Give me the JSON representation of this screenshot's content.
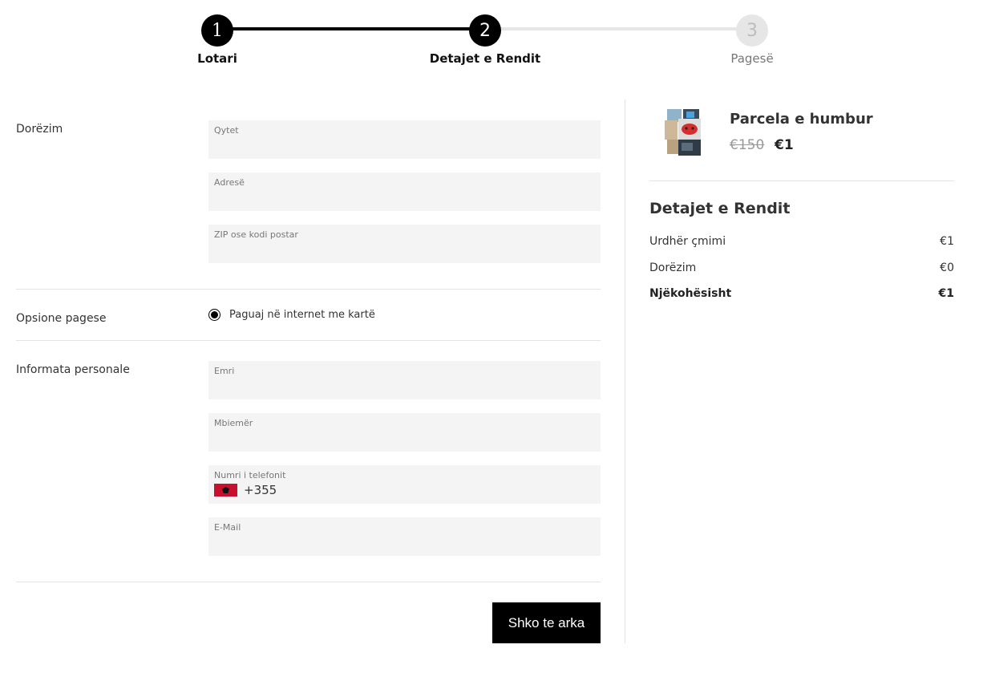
{
  "stepper": {
    "steps": [
      {
        "number": "1",
        "label": "Lotari"
      },
      {
        "number": "2",
        "label": "Detajet e Rendit"
      },
      {
        "number": "3",
        "label": "Pagesë"
      }
    ]
  },
  "form": {
    "delivery": {
      "label": "Dorëzim",
      "city_placeholder": "Qytet",
      "address_placeholder": "Adresë",
      "zip_placeholder": "ZIP ose kodi postar"
    },
    "payment": {
      "label": "Opsione pagese",
      "option_label": "Paguaj në internet me kartë"
    },
    "personal": {
      "label": "Informata personale",
      "name_placeholder": "Emri",
      "surname_placeholder": "Mbiemër",
      "phone_placeholder": "Numri i telefonit",
      "phone_code": "+355",
      "email_placeholder": "E-Mail"
    },
    "submit_label": "Shko te arka"
  },
  "summary": {
    "product": {
      "title": "Parcela e humbur",
      "old_price": "€150",
      "new_price": "€1"
    },
    "title": "Detajet e Rendit",
    "rows": [
      {
        "label": "Urdhër çmimi",
        "value": "€1"
      },
      {
        "label": "Dorëzim",
        "value": "€0"
      },
      {
        "label": "Njëkohësisht",
        "value": "€1"
      }
    ]
  }
}
